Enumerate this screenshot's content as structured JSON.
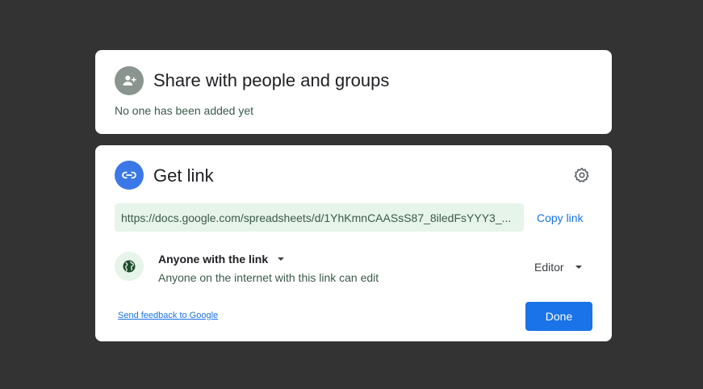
{
  "share_section": {
    "title": "Share with people and groups",
    "status": "No one has been added yet",
    "icon": "person-add-icon"
  },
  "link_section": {
    "title": "Get link",
    "icon": "link-icon",
    "settings_icon": "gear-icon",
    "url": "https://docs.google.com/spreadsheets/d/1YhKmnCAASsS87_8iledFsYYY3_...",
    "copy_label": "Copy link",
    "access": {
      "label": "Anyone with the link",
      "description": "Anyone on the internet with this link can edit",
      "icon": "globe-icon"
    },
    "role": {
      "selected": "Editor"
    }
  },
  "footer": {
    "feedback_label": "Send feedback to Google",
    "done_label": "Done"
  },
  "colors": {
    "backdrop": "#333333",
    "primary_blue": "#1a73e8",
    "link_icon_blue": "#3b78e7",
    "share_icon_gray": "#8a958f",
    "url_bg_green": "#e6f4ea"
  }
}
